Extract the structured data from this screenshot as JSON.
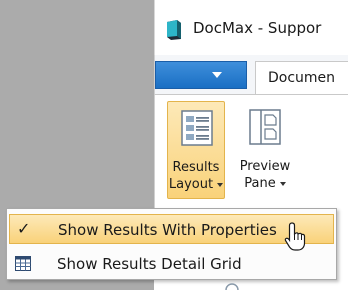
{
  "window": {
    "title": "DocMax - Suppor",
    "app_icon": "docmax-app-icon"
  },
  "tabs": {
    "file_menu_icon": "chevron-down-icon",
    "active_tab": "Documen"
  },
  "ribbon": {
    "results_layout": {
      "line1": "Results",
      "line2": "Layout",
      "icon": "results-layout-icon",
      "state": "pressed"
    },
    "preview_pane": {
      "line1": "Preview",
      "line2": "Pane",
      "icon": "preview-pane-icon"
    }
  },
  "menu": {
    "items": [
      {
        "label": "Show Results With Properties",
        "checked": true,
        "icon": "check-icon",
        "highlighted": true
      },
      {
        "label": "Show Results Detail Grid",
        "checked": false,
        "icon": "grid-icon",
        "highlighted": false
      }
    ]
  },
  "colors": {
    "file_button": "#1a6fc4",
    "highlight_fill": "#f9d27a",
    "highlight_border": "#e3b44c",
    "background_gray": "#ababab"
  },
  "cursor": "mouse-pointer-icon"
}
